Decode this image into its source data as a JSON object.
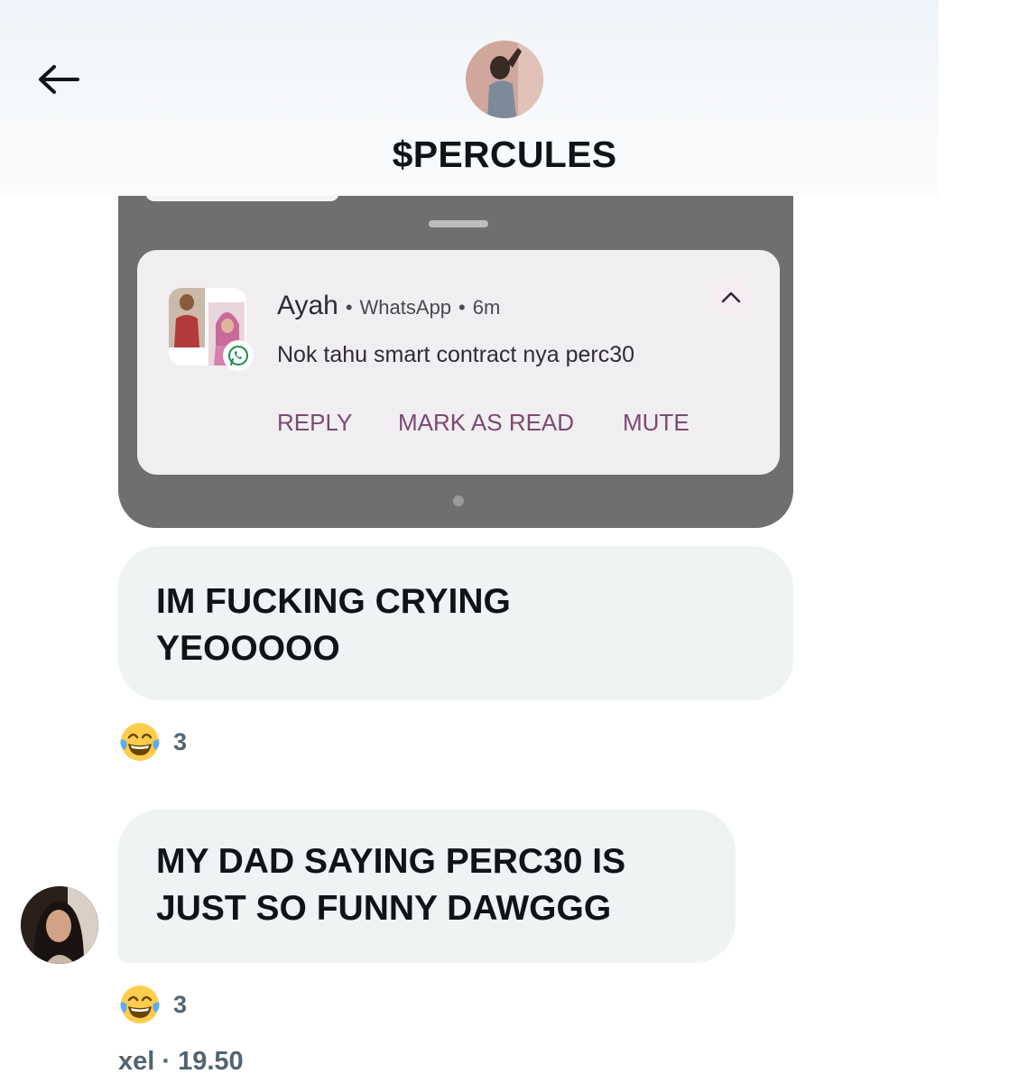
{
  "header": {
    "title": "$PERCULES"
  },
  "notification": {
    "sender": "Ayah",
    "app": "WhatsApp",
    "time": "6m",
    "message": "Nok tahu smart contract nya perc30",
    "actions": [
      "REPLY",
      "MARK AS READ",
      "MUTE"
    ]
  },
  "messages": [
    {
      "line1": "IM FUCKING CRYING",
      "line2": "YEOOOOO",
      "reaction": {
        "emoji": "face-with-tears-of-joy-icon",
        "count": "3"
      }
    },
    {
      "line1": "MY DAD SAYING PERC30 IS",
      "line2": "JUST SO FUNNY DAWGGG",
      "reaction": {
        "emoji": "face-with-tears-of-joy-icon",
        "count": "3"
      }
    }
  ],
  "footer": {
    "meta": "xel · 19.50"
  },
  "colors": {
    "bubble": "#eff3f4",
    "phone_frame": "#6f6f6f",
    "notification_card": "#f1eef1",
    "action_text": "#7b4a73",
    "secondary_text": "#536471"
  }
}
